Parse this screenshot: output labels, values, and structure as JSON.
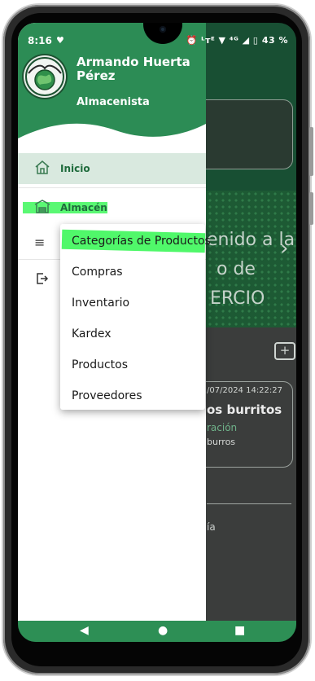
{
  "status_bar": {
    "time": "8:16",
    "notification_icon": "heart-icon",
    "indicators": "⏰ ᴸᴛᴱ ▼ ⁴ᴳ ◢ ▯",
    "battery": "43 %"
  },
  "drawer": {
    "user_name": "Armando Huerta Pérez",
    "user_role": "Almacenista",
    "items": [
      {
        "label": "Inicio",
        "icon": "home-icon"
      },
      {
        "label": "Almacén",
        "icon": "warehouse-icon"
      }
    ],
    "extra_icons": [
      "menu-icon",
      "logout-icon"
    ]
  },
  "popup_menu": {
    "items": [
      {
        "label": "Categorías de Productos",
        "highlighted": true
      },
      {
        "label": "Compras"
      },
      {
        "label": "Inventario"
      },
      {
        "label": "Kardex"
      },
      {
        "label": "Productos"
      },
      {
        "label": "Proveedores"
      }
    ]
  },
  "background": {
    "banner_line1": "enido a la",
    "banner_line2": "o de",
    "banner_line3": "ERCIO",
    "banner_arrow": "›",
    "card_date": "/07/2024 14:22:27",
    "card_title": "os burritos",
    "card_sub1": "ración",
    "card_sub2": "burros",
    "lower_text": "ía"
  },
  "navbar": {
    "back": "◀",
    "home": "●",
    "recents": "■"
  },
  "colors": {
    "brand_green": "#2c8c55",
    "active_item_bg": "#d9e9df",
    "highlight_marker": "#3df75a"
  }
}
